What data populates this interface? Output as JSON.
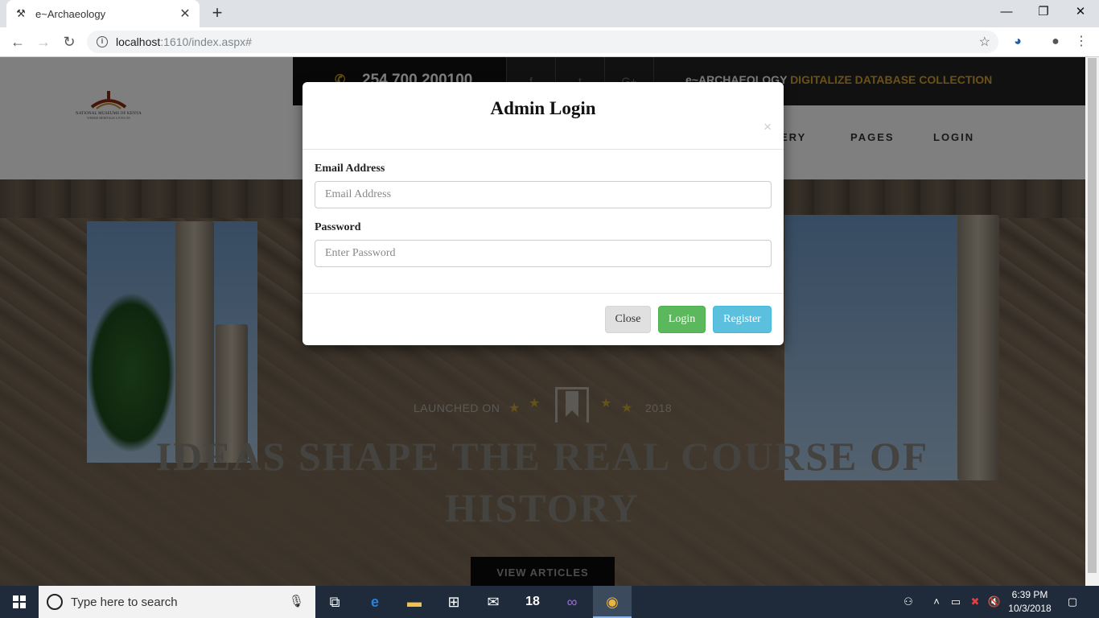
{
  "browser": {
    "tab_title": "e~Archaeology",
    "tab_close": "✕",
    "new_tab": "+",
    "url_host": "localhost",
    "url_path": ":1610/index.aspx#",
    "window_controls": {
      "minimize": "—",
      "maximize": "❐",
      "close": "✕"
    }
  },
  "site": {
    "logo_text": "NATIONAL MUSEUMS OF KENYA",
    "logo_sub": "WHERE HERITAGE LIVES ON",
    "phone": "254 700 200100",
    "social": [
      "f",
      "t",
      "G+"
    ],
    "tagline_prefix": "e~ARCHAEOLOGY",
    "tagline_highlight": "DIGITALIZE DATABASE COLLECTION",
    "nav": [
      "ERY",
      "PAGES",
      "LOGIN"
    ]
  },
  "hero": {
    "launched_label": "LAUNCHED ON",
    "year": "2018",
    "title": "IDEAS SHAPE THE REAL COURSE OF HISTORY",
    "button": "VIEW ARTICLES"
  },
  "modal": {
    "title": "Admin Login",
    "close_x": "×",
    "email_label": "Email Address",
    "email_placeholder": "Email Address",
    "email_value": "",
    "password_label": "Password",
    "password_placeholder": "Enter Password",
    "password_value": "",
    "btn_close": "Close",
    "btn_login": "Login",
    "btn_register": "Register",
    "colors": {
      "login": "#5cb85c",
      "register": "#5bc0de",
      "close": "#e0e0e0"
    }
  },
  "taskbar": {
    "search_placeholder": "Type here to search",
    "badge_18": "18",
    "time": "6:39 PM",
    "date": "10/3/2018"
  }
}
